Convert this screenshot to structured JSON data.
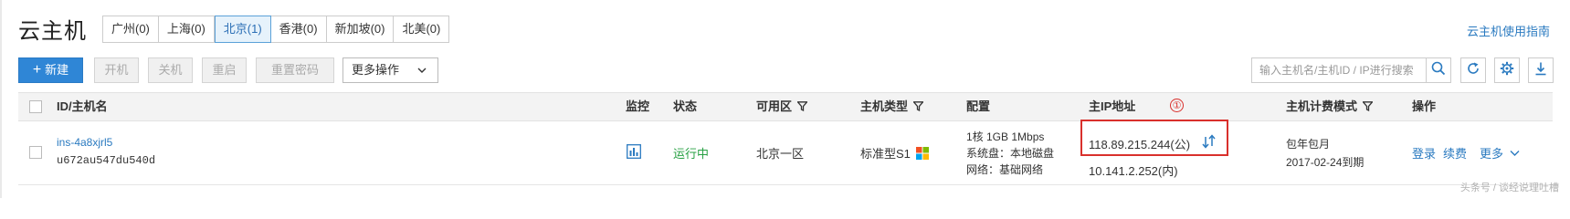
{
  "header": {
    "title": "云主机",
    "regions": [
      {
        "label": "广州(0)",
        "active": false
      },
      {
        "label": "上海(0)",
        "active": false
      },
      {
        "label": "北京(1)",
        "active": true
      },
      {
        "label": "香港(0)",
        "active": false
      },
      {
        "label": "新加坡(0)",
        "active": false
      },
      {
        "label": "北美(0)",
        "active": false
      }
    ],
    "guide_link": "云主机使用指南"
  },
  "toolbar": {
    "new_label": "新建",
    "power_on": "开机",
    "power_off": "关机",
    "restart": "重启",
    "reset_password": "重置密码",
    "more_actions": "更多操作",
    "search_placeholder": "输入主机名/主机ID / IP进行搜索",
    "search_icon": "search-icon",
    "refresh_icon": "refresh-icon",
    "settings_icon": "gear-icon",
    "download_icon": "download-icon"
  },
  "table": {
    "headers": {
      "id_name": "ID/主机名",
      "monitor": "监控",
      "status": "状态",
      "zone": "可用区",
      "type": "主机类型",
      "config": "配置",
      "ip": "主IP地址",
      "billing": "主机计费模式",
      "actions": "操作"
    },
    "rows": [
      {
        "id": "ins-4a8xjrl5",
        "hostname": "u672au547du540d",
        "status": "运行中",
        "zone": "北京一区",
        "type": "标准型S1",
        "config_line1": "1核 1GB 1Mbps",
        "config_line2": "系统盘：本地磁盘",
        "config_line3": "网络：基础网络",
        "public_ip": "118.89.215.244(公)",
        "private_ip": "10.141.2.252(内)",
        "billing_mode": "包年包月",
        "expiry": "2017-02-24到期",
        "action_login": "登录",
        "action_renew": "续费",
        "action_more": "更多"
      }
    ]
  },
  "annotation": {
    "marker": "①"
  },
  "watermark": "头条号 / 谈经说理吐槽",
  "colors": {
    "primary": "#2f86d6",
    "link": "#2a7ac0",
    "running": "#27a043",
    "highlight": "#d9302c"
  }
}
